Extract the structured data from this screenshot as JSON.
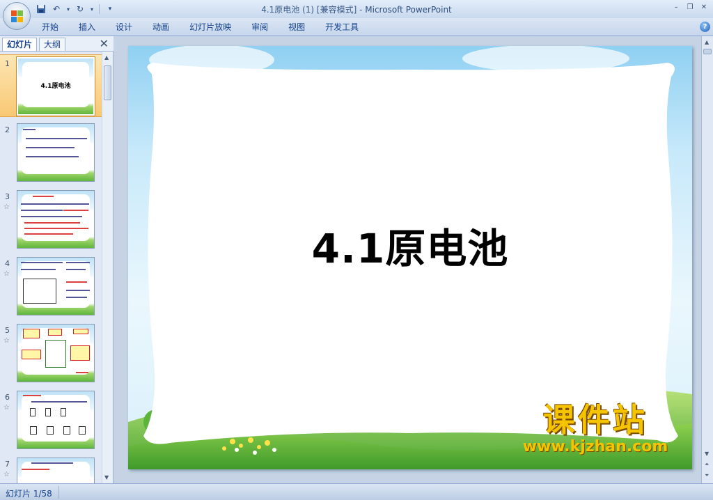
{
  "window": {
    "title": "4.1原电池 (1) [兼容模式]",
    "title_sep": " - ",
    "app_name": "Microsoft PowerPoint"
  },
  "quick_access": {
    "save_icon": "save-icon",
    "undo_icon": "undo-icon",
    "redo_icon": "redo-icon",
    "customize_icon": "customize-icon"
  },
  "ribbon": {
    "tabs": [
      "开始",
      "插入",
      "设计",
      "动画",
      "幻灯片放映",
      "审阅",
      "视图",
      "开发工具"
    ],
    "help_label": "?"
  },
  "left_pane": {
    "tab_slides": "幻灯片",
    "tab_outline": "大纲",
    "close_label": "✕",
    "thumbnails": [
      {
        "number": "1",
        "title": "4.1原电池",
        "selected": true,
        "has_animation": false
      },
      {
        "number": "2",
        "title": "",
        "selected": false,
        "has_animation": false
      },
      {
        "number": "3",
        "title": "",
        "selected": false,
        "has_animation": true
      },
      {
        "number": "4",
        "title": "",
        "selected": false,
        "has_animation": true
      },
      {
        "number": "5",
        "title": "",
        "selected": false,
        "has_animation": true
      },
      {
        "number": "6",
        "title": "",
        "selected": false,
        "has_animation": true
      },
      {
        "number": "7",
        "title": "",
        "selected": false,
        "has_animation": true
      }
    ],
    "animation_glyph": "☆"
  },
  "slide": {
    "title": "4.1原电池"
  },
  "watermark": {
    "main": "课件站",
    "url": "www.kjzhan.com"
  },
  "status": {
    "slide_counter": "幻灯片 1/58"
  },
  "colors": {
    "ribbon_text": "#15428b",
    "selected_thumb": "#f8c874",
    "watermark": "#f5c400"
  }
}
